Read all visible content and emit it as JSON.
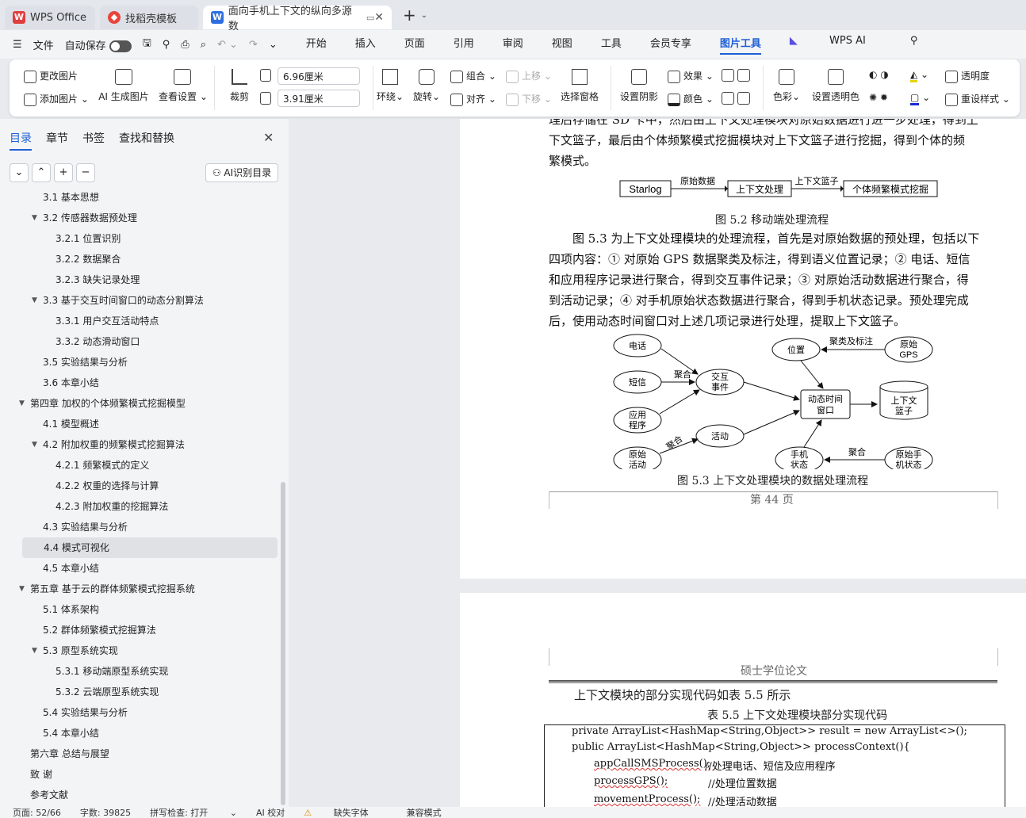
{
  "tabs": {
    "t1": "WPS Office",
    "t2": "找稻壳模板",
    "t3": "面向手机上下文的纵向多源数"
  },
  "menubar": {
    "file": "文件",
    "autosave": "自动保存",
    "tabs": [
      "开始",
      "插入",
      "页面",
      "引用",
      "审阅",
      "视图",
      "工具",
      "会员专享",
      "图片工具",
      "WPS AI"
    ],
    "active": "图片工具"
  },
  "ribbon": {
    "change_image": "更改图片",
    "add_image": "添加图片",
    "ai_gen": "AI 生成图片",
    "view_settings": "查看设置",
    "crop": "裁剪",
    "width": "6.96厘米",
    "height": "3.91厘米",
    "wrap": "环绕",
    "rotate": "旋转",
    "group": "组合",
    "align": "对齐",
    "move_up": "上移",
    "move_down": "下移",
    "select_pane": "选择窗格",
    "shadow": "设置阴影",
    "effect": "效果",
    "color": "颜色",
    "color_tone": "色彩",
    "transparent_color": "设置透明色",
    "transparency": "透明度",
    "reset_style": "重设样式"
  },
  "sidebar": {
    "tabs": [
      "目录",
      "章节",
      "书签",
      "查找和替换"
    ],
    "ai_toc": "AI识别目录",
    "items": [
      {
        "t": "3.1   基本思想",
        "lvl": 2
      },
      {
        "t": "3.2  传感器数据预处理",
        "lvl": 2,
        "arrow": true
      },
      {
        "t": "3.2.1  位置识别",
        "lvl": 3
      },
      {
        "t": "3.2.2  数据聚合",
        "lvl": 3
      },
      {
        "t": "3.2.3  缺失记录处理",
        "lvl": 3
      },
      {
        "t": "3.3  基于交互时间窗口的动态分割算法",
        "lvl": 2,
        "arrow": true
      },
      {
        "t": "3.3.1  用户交互活动特点",
        "lvl": 3
      },
      {
        "t": "3.3.2  动态滑动窗口",
        "lvl": 3
      },
      {
        "t": "3.5  实验结果与分析",
        "lvl": 2
      },
      {
        "t": "3.6  本章小结",
        "lvl": 2
      },
      {
        "t": "第四章   加权的个体频繁模式挖掘模型",
        "lvl": 1,
        "arrow": true
      },
      {
        "t": "4.1  模型概述",
        "lvl": 2
      },
      {
        "t": "4.2  附加权重的频繁模式挖掘算法",
        "lvl": 2,
        "arrow": true
      },
      {
        "t": "4.2.1  频繁模式的定义",
        "lvl": 3
      },
      {
        "t": "4.2.2  权重的选择与计算",
        "lvl": 3
      },
      {
        "t": "4.2.3  附加权重的挖掘算法",
        "lvl": 3
      },
      {
        "t": "4.3  实验结果与分析",
        "lvl": 2
      },
      {
        "t": "4.4  模式可视化",
        "lvl": 2,
        "selected": true
      },
      {
        "t": "4.5  本章小结",
        "lvl": 2
      },
      {
        "t": "第五章   基于云的群体频繁模式挖掘系统",
        "lvl": 1,
        "arrow": true
      },
      {
        "t": "5.1  体系架构",
        "lvl": 2
      },
      {
        "t": "5.2  群体频繁模式挖掘算法",
        "lvl": 2
      },
      {
        "t": "5.3  原型系统实现",
        "lvl": 2,
        "arrow": true
      },
      {
        "t": "5.3.1  移动端原型系统实现",
        "lvl": 3
      },
      {
        "t": "5.3.2  云端原型系统实现",
        "lvl": 3
      },
      {
        "t": "5.4  实验结果与分析",
        "lvl": 2
      },
      {
        "t": "5.4  本章小结",
        "lvl": 2
      },
      {
        "t": "第六章   总结与展望",
        "lvl": 1
      },
      {
        "t": "致   谢",
        "lvl": 1
      },
      {
        "t": "参考文献",
        "lvl": 1
      }
    ]
  },
  "page1": {
    "para1_l1": "理后存储在 SD 卡中，然后由上下文处理模块对原始数据进行进一步处理，得到上",
    "para1_l2": "下文篮子，最后由个体频繁模式挖掘模块对上下文篮子进行挖掘，得到个体的频",
    "para1_l3": "繁模式。",
    "fig52": {
      "starlog": "Starlog",
      "raw": "原始数据",
      "ctx": "上下文处理",
      "basket": "上下文篮子",
      "mining": "个体频繁模式挖掘"
    },
    "cap52": "图 5.2   移动端处理流程",
    "para2": [
      "图 5.3 为上下文处理模块的处理流程，首先是对原始数据的预处理，包括以下",
      "四项内容：① 对原始 GPS 数据聚类及标注，得到语义位置记录；② 电话、短信",
      "和应用程序记录进行聚合，得到交互事件记录；③ 对原始活动数据进行聚合，得",
      "到活动记录；④ 对手机原始状态数据进行聚合，得到手机状态记录。预处理完成",
      "后，使用动态时间窗口对上述几项记录进行处理，提取上下文篮子。"
    ],
    "fig53": {
      "phone": "电话",
      "sms": "短信",
      "app1": "应用",
      "app2": "程序",
      "act_raw1": "原始",
      "act_raw2": "活动",
      "interact1": "交互",
      "interact2": "事件",
      "activity": "活动",
      "location": "位置",
      "gps1": "原始",
      "gps2": "GPS",
      "window1": "动态时间",
      "window2": "窗口",
      "basket1": "上下文",
      "basket2": "篮子",
      "state1": "手机",
      "state2": "状态",
      "rawstate1": "原始手",
      "rawstate2": "机状态",
      "agg": "聚合",
      "cluster": "聚类及标注"
    },
    "cap53": "图 5.3    上下文处理模块的数据处理流程",
    "pagenum": "第  44  页"
  },
  "page2": {
    "header": "硕士学位论文",
    "intro": "上下文模块的部分实现代码如表 5.5 所示",
    "tablecap": "表 5.5  上下文处理模块部分实现代码",
    "code1": "private ArrayList<HashMap<String,Object>> result = new ArrayList<>();",
    "code2": "public ArrayList<HashMap<String,Object>> processContext(){",
    "code3": "appCallSMSProcess();",
    "code3c": "//处理电话、短信及应用程序",
    "code4": "processGPS();",
    "code4c": "//处理位置数据",
    "code5": "movementProcess();",
    "code5c": "//处理活动数据"
  },
  "status": {
    "page": "页面: 52/66",
    "words": "字数: 39825",
    "spell": "拼写检查: 打开",
    "ai": "AI 校对",
    "font": "缺失字体",
    "mode": "兼容模式"
  }
}
